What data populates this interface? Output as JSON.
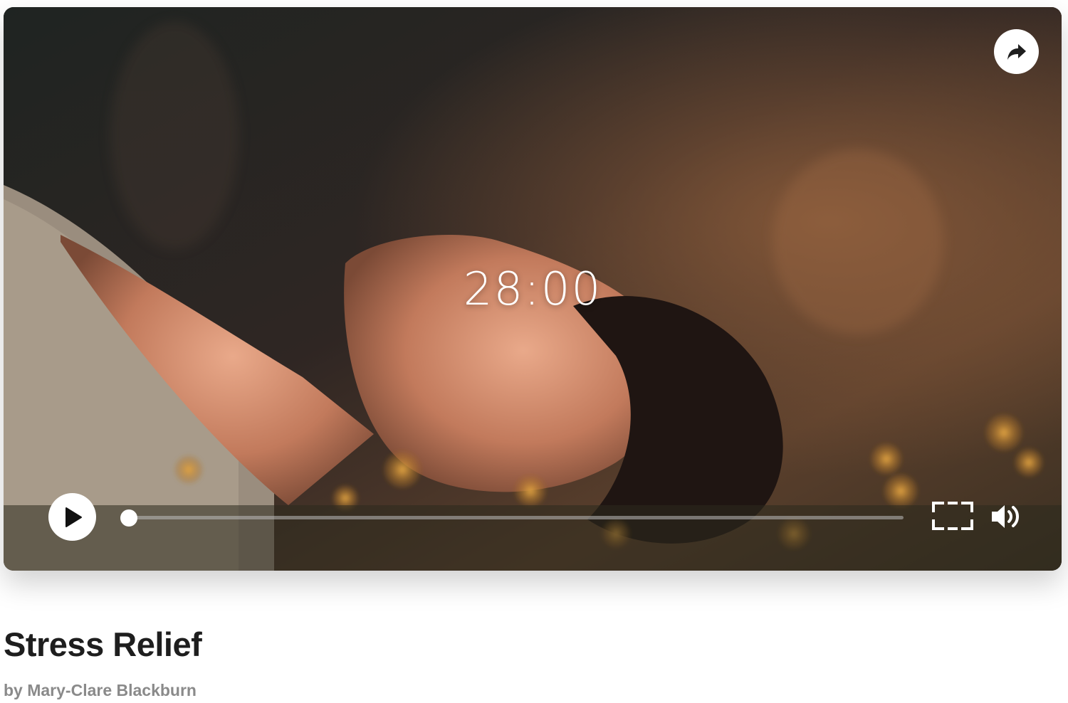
{
  "player": {
    "timer": "28:00",
    "progress": 0,
    "share_icon": "share-arrow-icon",
    "play_icon": "play-icon",
    "fullscreen_icon": "fullscreen-icon",
    "volume_icon": "volume-icon"
  },
  "meta": {
    "title": "Stress Relief",
    "byline": "by Mary-Clare Blackburn"
  },
  "colors": {
    "title": "#1e1e1e",
    "byline": "#8a8a8a",
    "controls": "#ffffff"
  }
}
